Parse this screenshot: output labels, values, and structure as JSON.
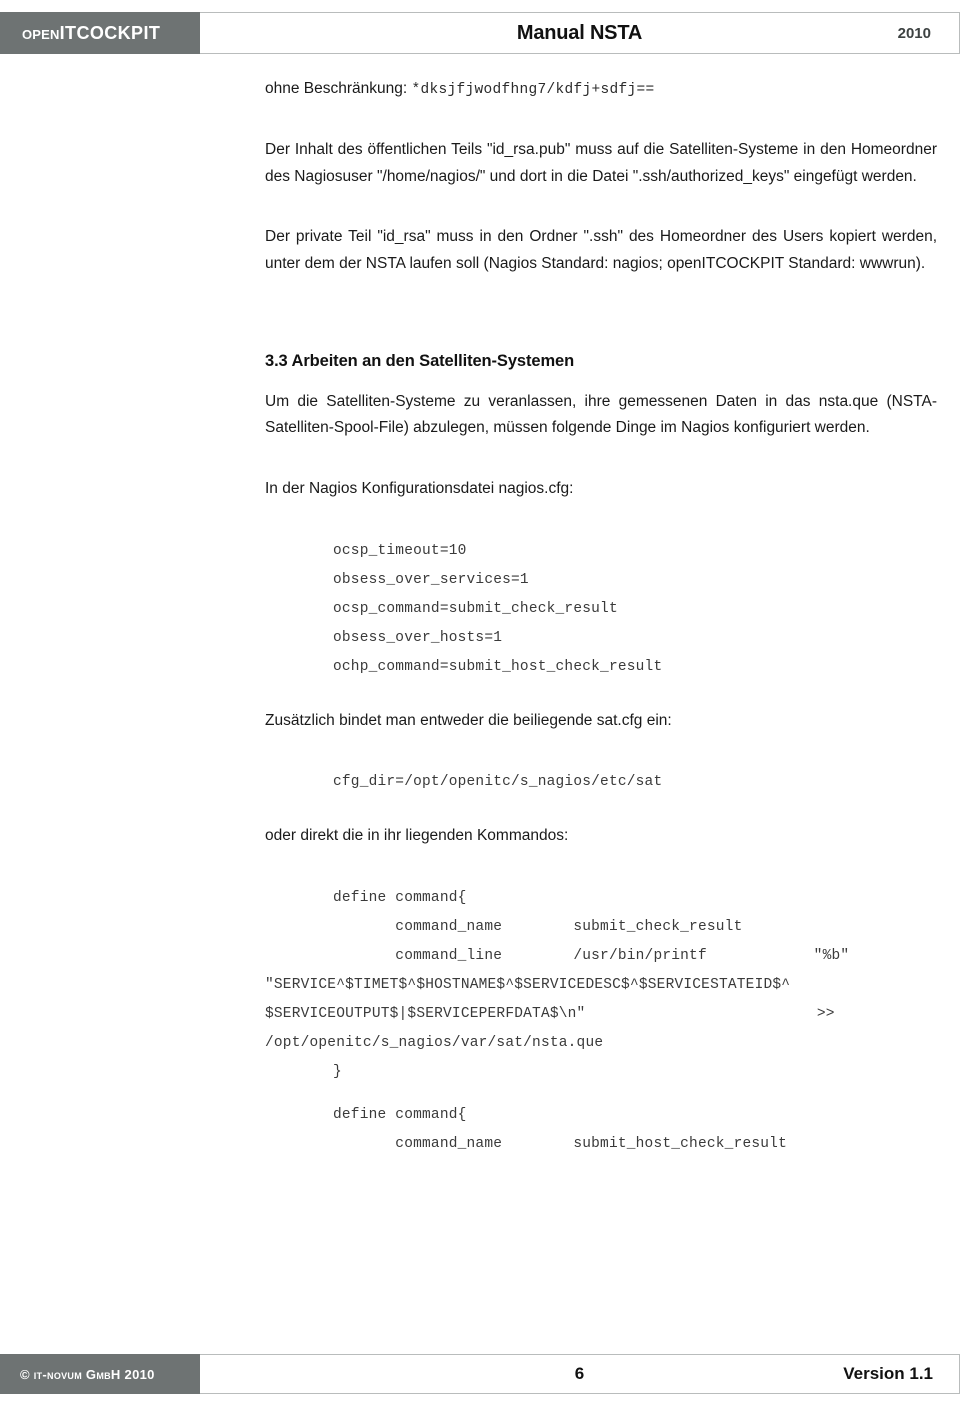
{
  "header": {
    "logo_open": "open",
    "logo_main": "ITCOCKPIT",
    "title": "Manual NSTA",
    "year": "2010"
  },
  "content": {
    "para_key_label": "ohne Beschränkung: ",
    "para_key_value": "*dksjfjwodfhng7/kdfj+sdfj==",
    "para_pub": "Der Inhalt des öffentlichen Teils \"id_rsa.pub\" muss auf die Satelliten-Systeme in den Homeordner des Nagiosuser \"/home/nagios/\" und dort in die Datei \".ssh/authorized_keys\" eingefügt werden.",
    "para_private": "Der private Teil \"id_rsa\" muss in den Ordner \".ssh\" des Homeordner des Users kopiert werden, unter dem der NSTA laufen soll (Nagios Standard: nagios; openITCOCKPIT Standard: wwwrun).",
    "heading_33": "3.3 Arbeiten an den Satelliten-Systemen",
    "para_satellite": "Um die Satelliten-Systeme zu veranlassen, ihre gemessenen Daten in das nsta.que (NSTA-Satelliten-Spool-File) abzulegen, müssen folgende Dinge im Nagios konfiguriert werden.",
    "para_nagios_cfg": "In der Nagios Konfigurationsdatei nagios.cfg:",
    "code_nagios_cfg": "ocsp_timeout=10\nobsess_over_services=1\nocsp_command=submit_check_result\nobsess_over_hosts=1\nochp_command=submit_host_check_result",
    "para_sat_cfg": "Zusätzlich bindet man entweder die beiliegende sat.cfg ein:",
    "code_cfg_dir": "cfg_dir=/opt/openitc/s_nagios/etc/sat",
    "para_kommandos": "oder direkt die in ihr liegenden Kommandos:",
    "code_define_service": "define command{\n       command_name        submit_check_result\n       command_line        /usr/bin/printf            \"%b\"",
    "code_service_args": "\"SERVICE^$TIMET$^$HOSTNAME$^$SERVICEDESC$^$SERVICESTATEID$^\n$SERVICEOUTPUT$|$SERVICEPERFDATA$\\n\"                          >>\n/opt/openitc/s_nagios/var/sat/nsta.que",
    "code_close_brace": "}",
    "code_define_host": "define command{\n       command_name        submit_host_check_result"
  },
  "footer": {
    "copyright": "© it-novum GmbH 2010",
    "page_number": "6",
    "version": "Version 1.1"
  },
  "colors": {
    "bar_gray": "#6e7373",
    "border_gray": "#b9bcbc",
    "text": "#1a1a1a"
  }
}
